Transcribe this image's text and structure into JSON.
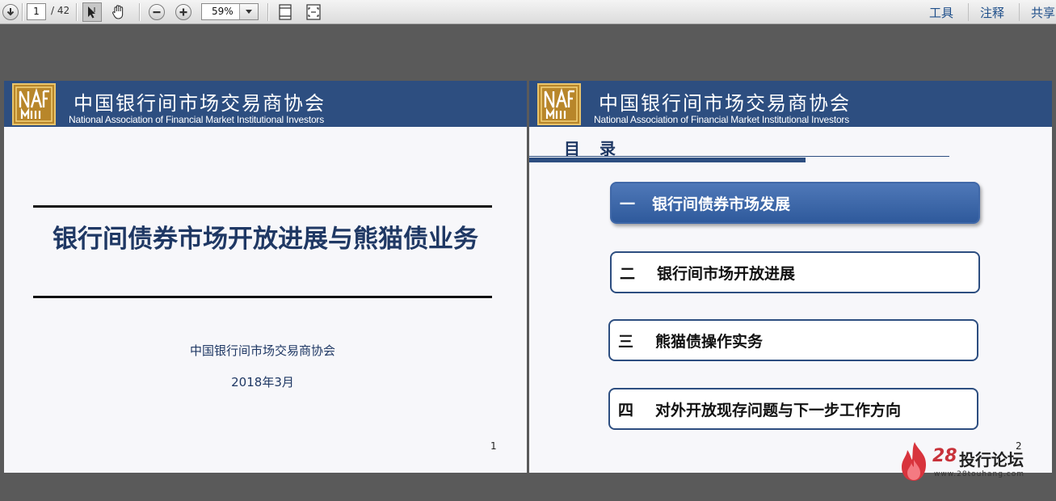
{
  "toolbar": {
    "current_page": "1",
    "page_total": "/ 42",
    "zoom": "59%",
    "menu": [
      "工具",
      "注释",
      "共享"
    ],
    "icons": [
      "download-icon",
      "select-arrow-icon",
      "hand-icon",
      "zoom-out-icon",
      "zoom-in-icon",
      "fit-page-icon",
      "fit-width-icon"
    ]
  },
  "slide1": {
    "header_cn": "中国银行间市场交易商协会",
    "header_en": "National Association of Financial Market Institutional Investors",
    "title": "银行间债券市场开放进展与熊猫债业务",
    "org": "中国银行间市场交易商协会",
    "date": "2018年3月",
    "page_number": "1"
  },
  "slide2": {
    "header_cn": "中国银行间市场交易商协会",
    "header_en": "National Association of Financial Market Institutional Investors",
    "toc_title": "目　录",
    "items": [
      {
        "num": "一",
        "label": "银行间债券市场发展"
      },
      {
        "num": "二",
        "label": "银行间市场开放进展"
      },
      {
        "num": "三",
        "label": "熊猫债操作实务"
      },
      {
        "num": "四",
        "label": "对外开放现存问题与下一步工作方向"
      }
    ],
    "page_number": "2"
  },
  "watermark": {
    "brand_num": "28",
    "brand_text": "投行论坛",
    "url": "www.28touhang.com"
  },
  "colors": {
    "header_blue": "#2d4e80",
    "title_navy": "#1f3864",
    "toc_active": "#3f67a9",
    "logo_gold": "#b8862a"
  }
}
